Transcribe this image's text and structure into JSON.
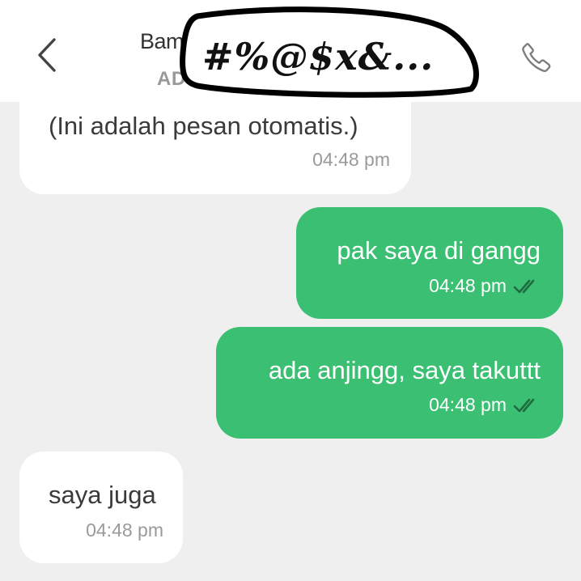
{
  "header": {
    "contact_name": "Bam",
    "contact_sub": "AD",
    "censor_text": "#%@$x&..."
  },
  "messages": [
    {
      "direction": "incoming",
      "text": "(Ini adalah pesan otomatis.)",
      "time": "04:48 pm"
    },
    {
      "direction": "outgoing",
      "text": "pak saya di gangg",
      "time": "04:48 pm",
      "status": "read"
    },
    {
      "direction": "outgoing",
      "text": "ada anjingg, saya takuttt",
      "time": "04:48 pm",
      "status": "read"
    },
    {
      "direction": "incoming",
      "text": "saya juga",
      "time": "04:48 pm"
    }
  ],
  "colors": {
    "outgoing_bubble": "#3bbf73",
    "incoming_bubble": "#ffffff",
    "chat_background": "#efefef",
    "read_tick": "#1e6b3f"
  },
  "icons": {
    "back": "chevron-left-icon",
    "call": "phone-icon",
    "read_status": "double-check-icon"
  }
}
